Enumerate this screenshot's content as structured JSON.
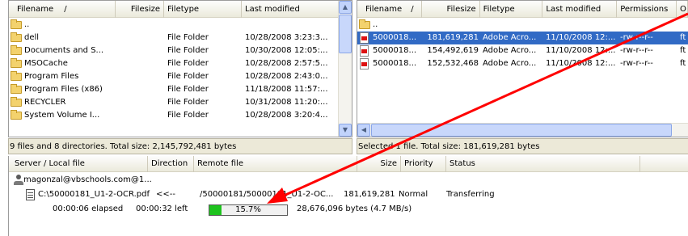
{
  "left_pane": {
    "columns": [
      "Filename",
      "/",
      "Filesize",
      "Filetype",
      "Last modified"
    ],
    "rows": [
      {
        "name": "..",
        "type": "",
        "modified": ""
      },
      {
        "name": "dell",
        "type": "File Folder",
        "modified": "10/28/2008 3:23:3..."
      },
      {
        "name": "Documents and S...",
        "type": "File Folder",
        "modified": "10/30/2008 12:05:..."
      },
      {
        "name": "MSOCache",
        "type": "File Folder",
        "modified": "10/28/2008 2:57:5..."
      },
      {
        "name": "Program Files",
        "type": "File Folder",
        "modified": "10/28/2008 2:43:0..."
      },
      {
        "name": "Program Files (x86)",
        "type": "File Folder",
        "modified": "11/18/2008 11:57:..."
      },
      {
        "name": "RECYCLER",
        "type": "File Folder",
        "modified": "10/31/2008 11:20:..."
      },
      {
        "name": "System Volume I...",
        "type": "File Folder",
        "modified": "10/28/2008 3:20:4..."
      }
    ],
    "status": "9 files and 8 directories. Total size: 2,145,792,481 bytes"
  },
  "right_pane": {
    "columns": [
      "Filename",
      "/",
      "Filesize",
      "Filetype",
      "Last modified",
      "Permissions",
      "O"
    ],
    "rows": [
      {
        "name": "..",
        "size": "",
        "type": "",
        "modified": "",
        "perms": "",
        "owner": ""
      },
      {
        "name": "5000018...",
        "size": "181,619,281",
        "type": "Adobe Acro...",
        "modified": "11/10/2008 12:...",
        "perms": "-rw-r--r--",
        "owner": "ft",
        "selected": true
      },
      {
        "name": "5000018...",
        "size": "154,492,619",
        "type": "Adobe Acro...",
        "modified": "11/10/2008 12:...",
        "perms": "-rw-r--r--",
        "owner": "ft"
      },
      {
        "name": "5000018...",
        "size": "152,532,468",
        "type": "Adobe Acro...",
        "modified": "11/10/2008 12:...",
        "perms": "-rw-r--r--",
        "owner": "ft"
      }
    ],
    "status": "Selected 1 file. Total size: 181,619,281 bytes"
  },
  "queue": {
    "columns": [
      "Server / Local file",
      "Direction",
      "Remote file",
      "Size",
      "Priority",
      "Status"
    ],
    "server": "magonzal@vbschools.com@1...",
    "transfer": {
      "local_file": "C:\\50000181_U1-2-OCR.pdf",
      "direction": "<<--",
      "remote_file": "/50000181/50000181_U1-2-OC...",
      "size": "181,619,281",
      "priority": "Normal",
      "status": "Transferring",
      "elapsed": "00:00:06 elapsed",
      "left": "00:00:32 left",
      "progress_label": "15.7%",
      "progress_fraction": 0.157,
      "bytes": "28,676,096 bytes (4.7 MB/s)"
    }
  },
  "icons": {
    "folder": "folder-icon",
    "pdf": "pdf-file-icon",
    "server": "server-icon",
    "file": "file-icon",
    "scroll_up": "scroll-up-icon",
    "scroll_down": "scroll-down-icon",
    "scroll_left": "scroll-left-icon"
  },
  "colors": {
    "selection": "#316ac5",
    "progress_fill": "#1ec31e",
    "annotation_arrow": "#ff0000"
  }
}
